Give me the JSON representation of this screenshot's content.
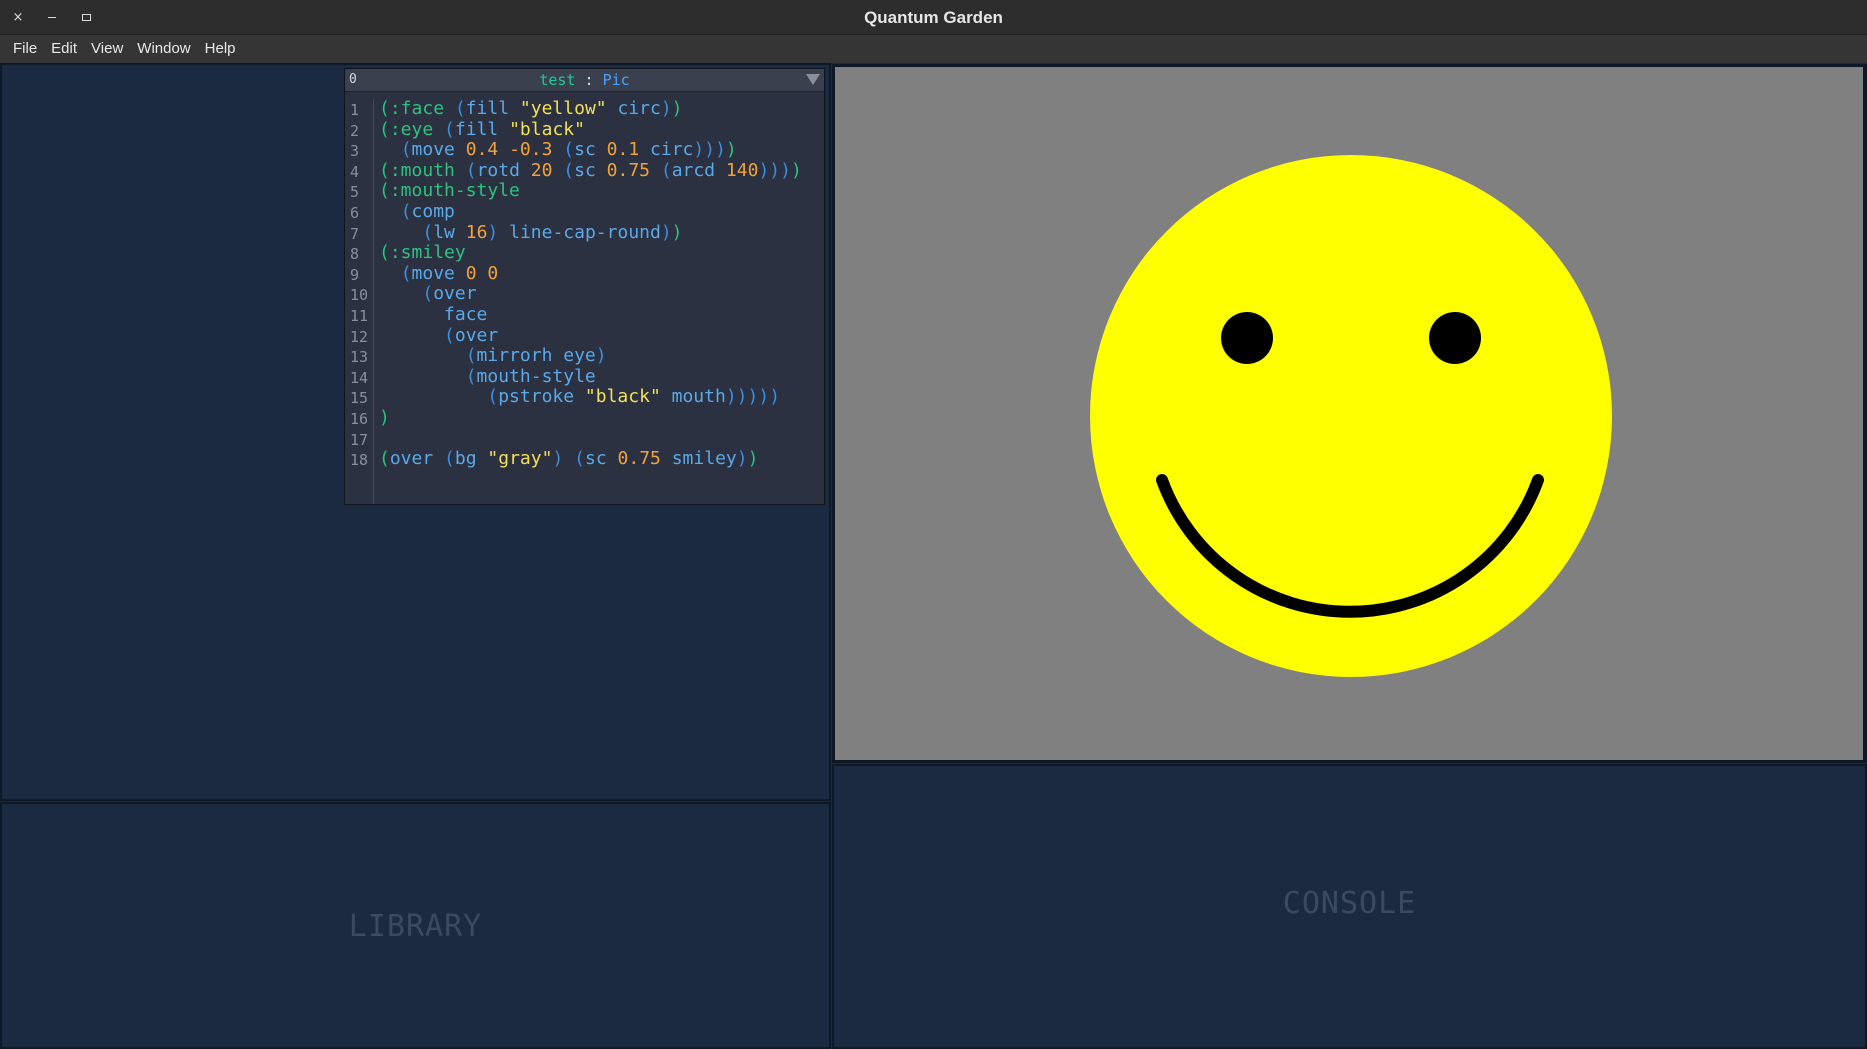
{
  "window": {
    "title": "Quantum Garden",
    "controls": {
      "close": "×",
      "minimize": "–",
      "maximize": "□"
    }
  },
  "menu": [
    "File",
    "Edit",
    "View",
    "Window",
    "Help"
  ],
  "editor": {
    "index": "0",
    "doc_name": "test",
    "separator": ":",
    "doc_kind": "Pic",
    "lines": [
      "(:face (fill \"yellow\" circ))",
      "(:eye (fill \"black\"",
      "  (move 0.4 -0.3 (sc 0.1 circ))))",
      "(:mouth (rotd 20 (sc 0.75 (arcd 140))))",
      "(:mouth-style",
      "  (comp",
      "    (lw 16) line-cap-round))",
      "(:smiley",
      "  (move 0 0",
      "    (over",
      "      face",
      "      (over",
      "        (mirrorh eye)",
      "        (mouth-style",
      "          (pstroke \"black\" mouth)))))",
      ")",
      "",
      "(over (bg \"gray\") (sc 0.75 smiley))"
    ]
  },
  "panels": {
    "library_label": "LIBRARY",
    "console_label": "CONSOLE"
  },
  "preview": {
    "background": "#808080",
    "face_color": "#ffff00",
    "feature_color": "#000000"
  },
  "colors": {
    "paren_outer": "#2ec27e",
    "paren_inner": "#3b8fe0",
    "string": "#f2e058",
    "number": "#f2a23a",
    "symbol": "#5aa9e8"
  }
}
